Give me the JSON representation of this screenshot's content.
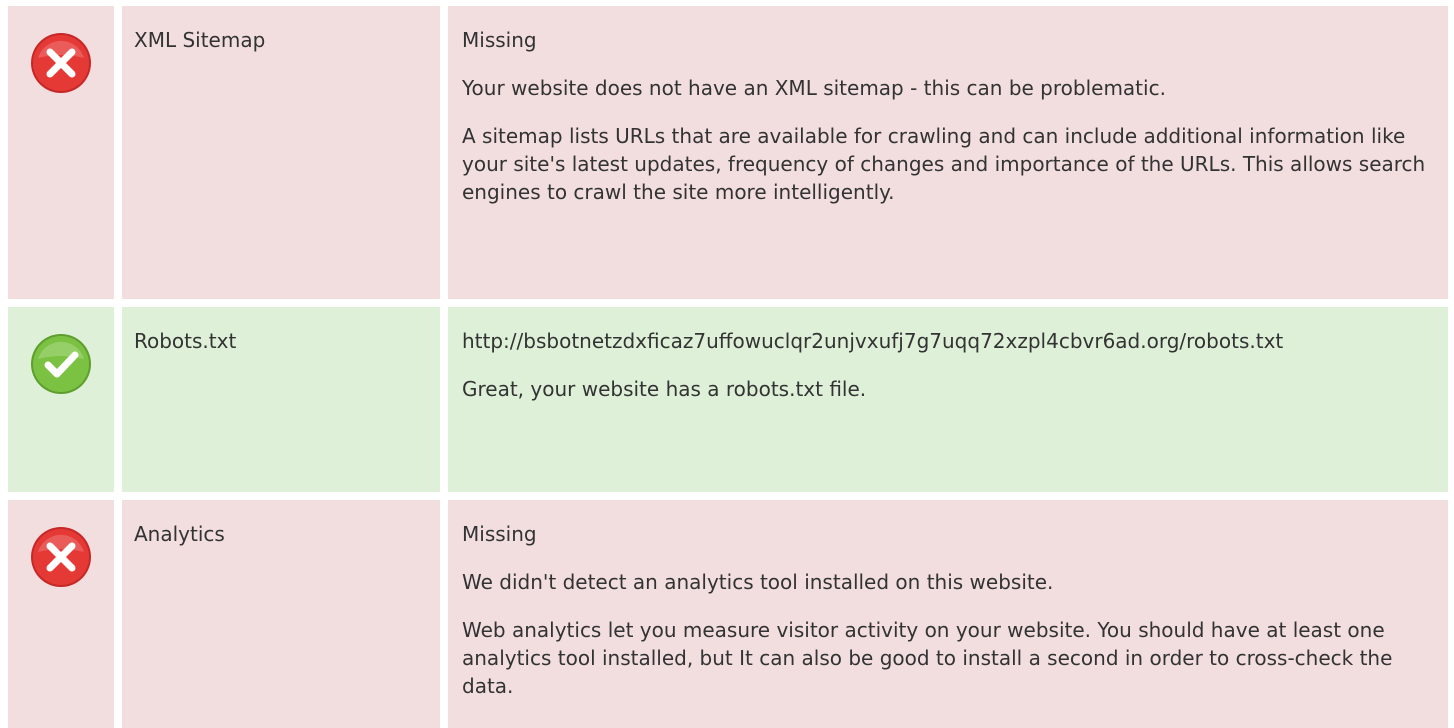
{
  "rows": [
    {
      "status": "fail",
      "icon": "error-x-icon",
      "label": "XML Sitemap",
      "value": "Missing",
      "paragraphs": [
        "Your website does not have an XML sitemap - this can be problematic.",
        "A sitemap lists URLs that are available for crawling and can include additional information like your site's latest updates, frequency of changes and importance of the URLs. This allows search engines to crawl the site more intelligently."
      ]
    },
    {
      "status": "pass",
      "icon": "success-check-icon",
      "label": "Robots.txt",
      "value": "http://bsbotnetzdxficaz7uffowuclqr2unjvxufj7g7uqq72xzpl4cbvr6ad.org/robots.txt",
      "paragraphs": [
        "Great, your website has a robots.txt file."
      ]
    },
    {
      "status": "fail",
      "icon": "error-x-icon",
      "label": "Analytics",
      "value": "Missing",
      "paragraphs": [
        "We didn't detect an analytics tool installed on this website.",
        "Web analytics let you measure visitor activity on your website. You should have at least one analytics tool installed, but It can also be good to install a second in order to cross-check the data."
      ]
    }
  ],
  "colors": {
    "fail_background": "#f2dedf",
    "pass_background": "#dff0d9",
    "fail_icon": "#e53935",
    "pass_icon": "#7cc242"
  }
}
